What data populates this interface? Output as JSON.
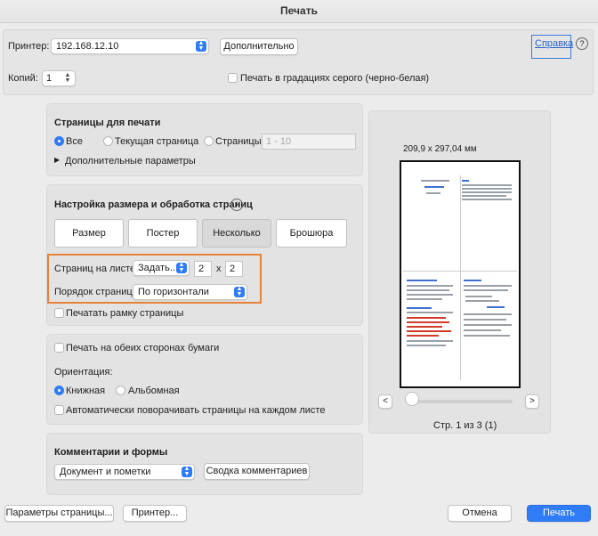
{
  "window": {
    "title": "Печать"
  },
  "printer": {
    "label": "Принтер:",
    "value": "192.168.12.10",
    "details_button": "Дополнительно"
  },
  "help": {
    "link": "Справка",
    "icon": "help-icon",
    "icon_glyph": "?"
  },
  "copies": {
    "label": "Копий:",
    "value": "1",
    "grayscale_label": "Печать в градациях серого (черно-белая)"
  },
  "pages_to_print": {
    "title": "Страницы для печати",
    "options": [
      "Все",
      "Текущая страница",
      "Страницы"
    ],
    "selected": "Все",
    "range_placeholder": "1 - 10",
    "more_options": "Дополнительные параметры"
  },
  "sizing": {
    "title": "Настройка размера и обработка страниц",
    "info_icon": "i",
    "tabs": [
      "Размер",
      "Постер",
      "Несколько",
      "Брошюра"
    ],
    "selected_tab": "Несколько",
    "pages_per_sheet_label": "Страниц на листе:",
    "pages_per_sheet_value": "Задать...",
    "cols": "2",
    "times": "x",
    "rows": "2",
    "page_order_label": "Порядок страниц:",
    "page_order_value": "По горизонтали",
    "print_border_label": "Печатать рамку страницы"
  },
  "orientation": {
    "duplex_label": "Печать на обеих сторонах бумаги",
    "label": "Ориентация:",
    "options": [
      "Книжная",
      "Альбомная"
    ],
    "selected": "Книжная",
    "auto_rotate_label": "Автоматически поворачивать страницы на каждом листе"
  },
  "comments": {
    "title": "Комментарии и формы",
    "value": "Документ и пометки",
    "summary_button": "Сводка комментариев"
  },
  "preview": {
    "size_label": "209,9 x 297,04 мм",
    "prev": "<",
    "next": ">",
    "page_info": "Стр. 1 из 3 (1)"
  },
  "footer": {
    "page_setup": "Параметры страницы...",
    "printer": "Принтер...",
    "cancel": "Отмена",
    "print": "Печать"
  },
  "colors": {
    "accent": "#2f7cf6",
    "highlight_box": "#e8823a",
    "help_box": "#3a7bd5"
  }
}
